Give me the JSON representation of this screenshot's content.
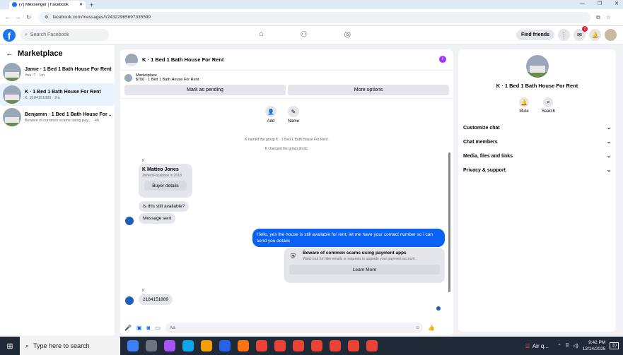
{
  "browser": {
    "tab_title": "(7) Messenger | Facebook",
    "url": "facebook.com/messages/t/24322965697335599",
    "new_tab": "+"
  },
  "fb_header": {
    "search_placeholder": "Search Facebook",
    "find_friends": "Find friends",
    "notification_count": "7"
  },
  "sidebar": {
    "title": "Marketplace",
    "conversations": [
      {
        "name": "Jamie · 1 Bed 1 Bath House For Rent",
        "sub": "You: ? · 1m"
      },
      {
        "name": "K · 1 Bed 1 Bath House For Rent",
        "sub": "K: 2184151889 · 2m"
      },
      {
        "name": "Benjamin · 1 Bed 1 Bath House For ...",
        "sub": "Beware of common scams using pay... · 4h"
      }
    ]
  },
  "chat": {
    "title": "K · 1 Bed 1 Bath House For Rent",
    "listing_label": "Marketplace",
    "listing_detail": "$700 · 1 Bed 1 Bath House For Rent",
    "mark_pending": "Mark as pending",
    "more_options": "More options",
    "add_label": "Add",
    "name_label": "Name",
    "sys_msg_1": "K named the group K · 1 Bed 1 Bath House For Rent.",
    "sys_msg_2": "K changed the group photo.",
    "sender_k": "K",
    "profile_name": "K Matteo Jones",
    "profile_joined": "Joined Facebook in 2018",
    "buyer_details": "Buyer details",
    "msg_available": "Is this still available?",
    "msg_sent": "Message sent",
    "my_msg": "Hello, yes the house is still available for rent, let me have your contact number so i can send you  details",
    "warn_title": "Beware of common scams using payment apps",
    "warn_sub": "Watch out for fake emails or requests to upgrade your payment account.",
    "learn_more": "Learn More",
    "sender_k2": "K",
    "msg_number": "2184151889",
    "compose_placeholder": "Aa"
  },
  "right_panel": {
    "title": "K · 1 Bed 1 Bath House For Rent",
    "mute": "Mute",
    "search": "Search",
    "sections": [
      "Customize chat",
      "Chat members",
      "Media, files and links",
      "Privacy & support"
    ]
  },
  "taskbar": {
    "search_placeholder": "Type here to search",
    "weather": "Air q...",
    "time": "9:42 PM",
    "date": "12/14/2025",
    "notif": "10"
  }
}
